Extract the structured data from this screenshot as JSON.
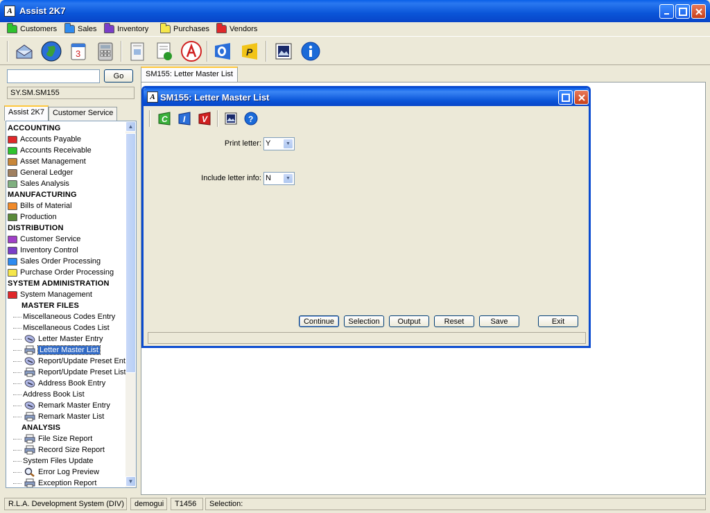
{
  "window": {
    "title": "Assist 2K7"
  },
  "menu": [
    {
      "label": "Customers",
      "color": "#2ec32e"
    },
    {
      "label": "Sales",
      "color": "#2e8bf0"
    },
    {
      "label": "Inventory",
      "color": "#7a3ec8"
    },
    {
      "label": "Purchases",
      "color": "#f5e64a"
    },
    {
      "label": "Vendors",
      "color": "#e0282a"
    }
  ],
  "toolbar_icons": [
    "mail-icon",
    "globe-icon",
    "calendar-icon",
    "calculator-icon",
    "address-card-icon",
    "report-icon",
    "acrobat-icon",
    "outlook-icon",
    "pinnacle-icon",
    "picture-icon",
    "info-icon"
  ],
  "search": {
    "value": "",
    "go_label": "Go"
  },
  "current_path": "SY.SM.SM155",
  "left_tabs": [
    "Assist 2K7",
    "Customer Service"
  ],
  "tree": [
    {
      "label": "ACCOUNTING",
      "kind": "header"
    },
    {
      "label": "Accounts Payable",
      "kind": "folder",
      "color": "#e0282a"
    },
    {
      "label": "Accounts Receivable",
      "kind": "folder",
      "color": "#2ec32e"
    },
    {
      "label": "Asset Management",
      "kind": "folder",
      "color": "#c8873a"
    },
    {
      "label": "General Ledger",
      "kind": "folder",
      "color": "#a08060"
    },
    {
      "label": "Sales Analysis",
      "kind": "folder",
      "color": "#80b080"
    },
    {
      "label": "MANUFACTURING",
      "kind": "header"
    },
    {
      "label": "Bills of Material",
      "kind": "folder",
      "color": "#f08a2a"
    },
    {
      "label": "Production",
      "kind": "folder",
      "color": "#5a8a3a"
    },
    {
      "label": "DISTRIBUTION",
      "kind": "header"
    },
    {
      "label": "Customer Service",
      "kind": "folder",
      "color": "#a040c8"
    },
    {
      "label": "Inventory Control",
      "kind": "folder",
      "color": "#7a3ec8"
    },
    {
      "label": "Sales Order Processing",
      "kind": "folder",
      "color": "#2e8bf0"
    },
    {
      "label": "Purchase Order Processing",
      "kind": "folder",
      "color": "#f5e64a"
    },
    {
      "label": "SYSTEM ADMINISTRATION",
      "kind": "header"
    },
    {
      "label": "System Management",
      "kind": "folder",
      "color": "#e0282a"
    },
    {
      "label": "MASTER FILES",
      "kind": "subheader"
    },
    {
      "label": "Miscellaneous Codes Entry",
      "kind": "leaf"
    },
    {
      "label": "Miscellaneous Codes List",
      "kind": "leaf"
    },
    {
      "label": "Letter Master Entry",
      "kind": "entry"
    },
    {
      "label": "Letter Master List",
      "kind": "print",
      "selected": true
    },
    {
      "label": "Report/Update Preset Entr",
      "kind": "entry"
    },
    {
      "label": "Report/Update Preset List",
      "kind": "print"
    },
    {
      "label": "Address Book Entry",
      "kind": "entry"
    },
    {
      "label": "Address Book List",
      "kind": "leaf"
    },
    {
      "label": "Remark Master Entry",
      "kind": "entry"
    },
    {
      "label": "Remark Master List",
      "kind": "print"
    },
    {
      "label": "ANALYSIS",
      "kind": "subheader"
    },
    {
      "label": "File Size Report",
      "kind": "print"
    },
    {
      "label": "Record Size Report",
      "kind": "print"
    },
    {
      "label": "System Files Update",
      "kind": "leaf"
    },
    {
      "label": "Error Log Preview",
      "kind": "search"
    },
    {
      "label": "Exception Report",
      "kind": "print"
    }
  ],
  "main_tab": "SM155: Letter Master List",
  "dialog": {
    "title": "SM155: Letter Master List",
    "toolbar_icons": [
      "c-icon",
      "i-icon",
      "v-icon",
      "picture-icon",
      "help-icon"
    ],
    "fields": [
      {
        "label": "Print letter:",
        "value": "Y"
      },
      {
        "label": "Include letter info:",
        "value": "N"
      }
    ],
    "buttons": [
      "Continue",
      "Selection",
      "Output",
      "Reset",
      "Save",
      "Exit"
    ]
  },
  "status": [
    "R.L.A. Development System (DIV)",
    "demogui",
    "T1456",
    "Selection:"
  ]
}
